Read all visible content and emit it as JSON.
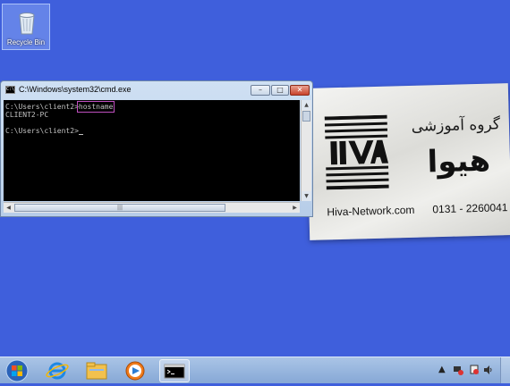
{
  "desktop": {
    "recycle_bin_label": "Recycle Bin"
  },
  "banner": {
    "persian_line1": "گروه آموزشی",
    "persian_line2": "هیوا",
    "website": "Hiva-Network.com",
    "phone": "0131 - 2260041"
  },
  "cmd_window": {
    "title": "C:\\Windows\\system32\\cmd.exe",
    "minimize_label": "–",
    "restore_label": "□",
    "close_label": "✕",
    "console": {
      "prompt1": "C:\\Users\\client2>",
      "command": "hostname",
      "output": "CLIENT2-PC",
      "prompt2": "C:\\Users\\client2>"
    },
    "hscroll_grip": "|||"
  },
  "colors": {
    "desktop_bg": "#3f5fdc",
    "highlight_box": "#c050c0",
    "console_bg": "#000000",
    "console_fg": "#c0c0c0"
  },
  "taskbar": {
    "items": [
      "start-orb",
      "internet-explorer-icon",
      "windows-explorer-icon",
      "media-player-icon",
      "cmd-icon"
    ],
    "tray_icons": [
      "arrow-up-icon",
      "network-icon",
      "action-center-icon",
      "volume-icon"
    ]
  }
}
